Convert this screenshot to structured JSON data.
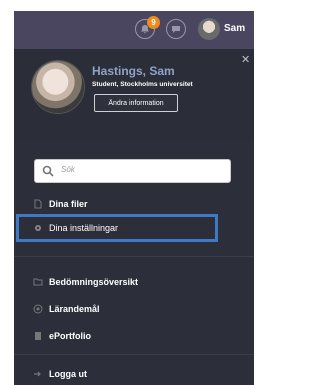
{
  "topbar": {
    "notification_count": "9",
    "username": "Sam",
    "icons": [
      "bell-icon",
      "chat-icon",
      "avatar"
    ]
  },
  "profile": {
    "name": "Hastings, Sam",
    "role": "Student, Stockholms universitet",
    "change_info_label": "Ändra information",
    "close_icon": "close-icon"
  },
  "menu": {
    "search_placeholder": "Sök",
    "items": [
      {
        "label": "Dina filer",
        "icon": "files-icon"
      },
      {
        "label": "Dina inställningar",
        "icon": "gear-icon"
      },
      {
        "label": "Bedömningsöversikt",
        "icon": "folder-icon"
      },
      {
        "label": "Lärandemål",
        "icon": "target-icon"
      },
      {
        "label": "ePortfolio",
        "icon": "portfolio-icon"
      },
      {
        "label": "Logga ut",
        "icon": "logout-icon"
      }
    ]
  },
  "colors": {
    "topbar": "#4a4660",
    "panel": "#2c2f3a",
    "name": "#8fa3c7",
    "badge": "#f08a1c",
    "highlight": "#3f78c5"
  }
}
